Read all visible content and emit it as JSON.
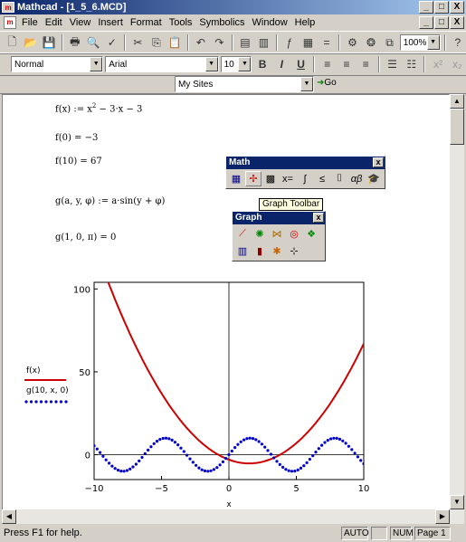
{
  "window": {
    "title": "Mathcad - [1_5_6.MCD]",
    "app_icon": "m",
    "buttons": [
      "_",
      "□",
      "X"
    ]
  },
  "menu": {
    "items": [
      "File",
      "Edit",
      "View",
      "Insert",
      "Format",
      "Tools",
      "Symbolics",
      "Window",
      "Help"
    ],
    "mdi_buttons": [
      "_",
      "□",
      "X"
    ]
  },
  "toolbar": {
    "zoom": "100%",
    "help_icon": "?"
  },
  "format_bar": {
    "style": "Normal",
    "font": "Arial",
    "size": "10",
    "bold": "B",
    "italic": "I",
    "underline": "U"
  },
  "url_bar": {
    "value": "My Sites",
    "go": "Go"
  },
  "worksheet": {
    "eq1": "f(x) := x",
    "eq1_exp": "2",
    "eq1_rest": " − 3·x − 3",
    "eq2": "f(0) = −3",
    "eq3": "f(10) = 67",
    "eq4": "g(a, y, φ) := a·sin(y + φ)",
    "eq5": "g(1, 0, π) = 0"
  },
  "math_palette": {
    "title": "Math",
    "close": "x",
    "icons": [
      "calculator-icon",
      "graph-icon",
      "matrix-icon",
      "evaluation-icon",
      "calculus-icon",
      "boolean-icon",
      "programming-icon",
      "greek-icon",
      "symbolic-icon"
    ]
  },
  "tooltip": "Graph Toolbar",
  "graph_palette": {
    "title": "Graph",
    "close": "x",
    "icons": [
      "xy-plot-icon",
      "polar-plot-icon",
      "surface-plot-icon",
      "contour-plot-icon",
      "scatter-3d-icon",
      "bar-3d-icon",
      "vector-field-icon",
      "zoom-icon",
      "trace-icon"
    ]
  },
  "chart_data": {
    "type": "line",
    "xlim": [
      -10,
      10
    ],
    "ylim": [
      -15,
      104
    ],
    "x_ticks": [
      "-10",
      "-5",
      "0",
      "5",
      "10"
    ],
    "y_ticks": [
      "100",
      "50",
      "0"
    ],
    "xlabel": "x",
    "series": [
      {
        "name": "f(x)",
        "style": "solid",
        "color": "#cc0000",
        "expr": "x^2 - 3x - 3"
      },
      {
        "name": "g(10, x, 0)",
        "style": "dotted",
        "color": "#0000cc",
        "expr": "10*sin(x)"
      }
    ]
  },
  "status": {
    "message": "Press F1 for help.",
    "mode": "AUTO",
    "num": "NUM",
    "page": "Page 1"
  }
}
